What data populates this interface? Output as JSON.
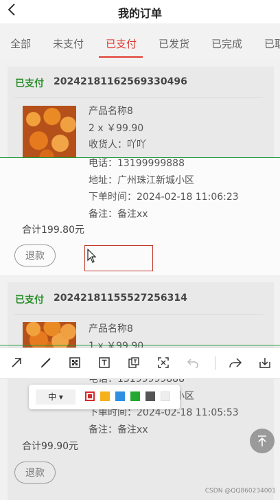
{
  "header": {
    "back_icon": "chevron-left-icon",
    "title": "我的订单"
  },
  "tabs": [
    {
      "label": "全部",
      "active": false
    },
    {
      "label": "未支付",
      "active": false
    },
    {
      "label": "已支付",
      "active": true
    },
    {
      "label": "已发货",
      "active": false
    },
    {
      "label": "已完成",
      "active": false
    },
    {
      "label": "已取",
      "active": false
    }
  ],
  "orders": [
    {
      "status": "已支付",
      "order_no": "20242181162569330496",
      "product_name": "产品名称8",
      "qty_price": "2 x ￥99.90",
      "receiver": "收货人：吖吖",
      "phone": "电话：13199999888",
      "address": "地址：广州珠江新城小区",
      "order_time": "下单时间：2024-02-18 11:06:23",
      "remark": "备注：备注xx",
      "total": "合计199.80元",
      "refund_label": "退款"
    },
    {
      "status": "已支付",
      "order_no": "20242181155527256314",
      "product_name": "产品名称8",
      "qty_price": "1 x ￥99.90",
      "phone": "电话：13199999888",
      "address": "地址：广州珠江新城小区",
      "order_time": "下单时间：2024-02-18 11:05:53",
      "remark": "备注：备注xx",
      "total": "合计99.90元",
      "refund_label": "退款"
    }
  ],
  "annotation_toolbar": {
    "tools": [
      "arrow-icon",
      "pen-icon",
      "mosaic-icon",
      "text-icon",
      "ocr-icon",
      "crop-icon",
      "undo-icon",
      "share-icon",
      "download-icon"
    ],
    "size_option": "中",
    "colors": [
      "#d42b2b",
      "#f5b01a",
      "#2f8fe0",
      "#24a832",
      "#555555",
      "#eeeeee"
    ]
  },
  "back_to_top_icon": "arrow-up-icon",
  "watermark": "CSDN @QQ860234001"
}
